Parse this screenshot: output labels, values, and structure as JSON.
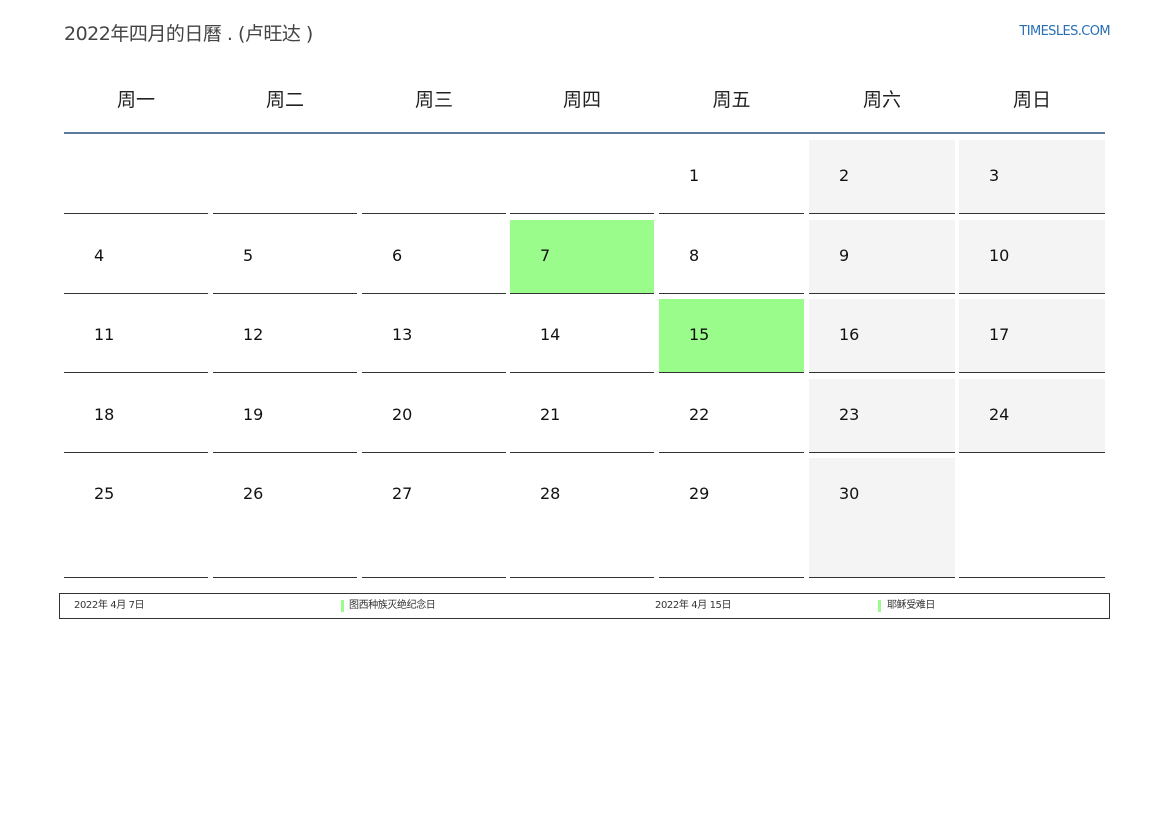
{
  "header": {
    "title": "2022年四月的日曆 . (卢旺达 )",
    "site": "TIMESLES.COM"
  },
  "weekdays": [
    "周一",
    "周二",
    "周三",
    "周四",
    "周五",
    "周六",
    "周日"
  ],
  "days": [
    "1",
    "2",
    "3",
    "4",
    "5",
    "6",
    "7",
    "8",
    "9",
    "10",
    "11",
    "12",
    "13",
    "14",
    "15",
    "16",
    "17",
    "18",
    "19",
    "20",
    "21",
    "22",
    "23",
    "24",
    "25",
    "26",
    "27",
    "28",
    "29",
    "30"
  ],
  "holiday_color": "#9afc8a",
  "weekend_color": "#f4f4f4",
  "legend": [
    {
      "date": "2022年 4月 7日",
      "name": "图西种族灭绝纪念日"
    },
    {
      "date": "2022年 4月 15日",
      "name": "耶稣受难日"
    }
  ]
}
